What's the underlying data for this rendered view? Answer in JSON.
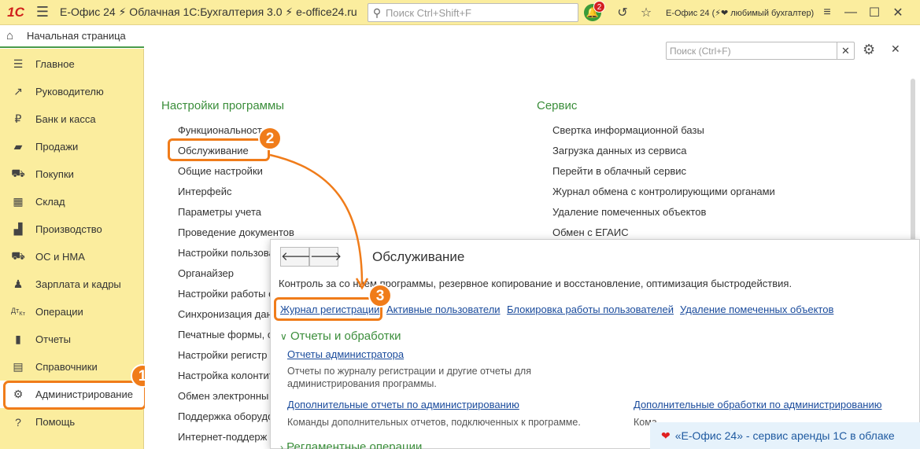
{
  "topbar": {
    "logo": "1С",
    "title": "Е-Офис 24 ⚡ Облачная 1С:Бухгалтерия 3.0 ⚡ e-office24.ru",
    "search_placeholder": "Поиск Ctrl+Shift+F",
    "notifications_count": "2",
    "user": "Е-Офис 24 (⚡❤ любимый бухгалтер)"
  },
  "home_tab": {
    "label": "Начальная страница"
  },
  "sidebar": {
    "items": [
      {
        "label": "Главное",
        "icon": "menu-icon"
      },
      {
        "label": "Руководителю",
        "icon": "chart-trend-icon"
      },
      {
        "label": "Банк и касса",
        "icon": "ruble-icon"
      },
      {
        "label": "Продажи",
        "icon": "bag-icon"
      },
      {
        "label": "Покупки",
        "icon": "cart-icon"
      },
      {
        "label": "Склад",
        "icon": "warehouse-icon"
      },
      {
        "label": "Производство",
        "icon": "factory-icon"
      },
      {
        "label": "ОС и НМА",
        "icon": "truck-icon"
      },
      {
        "label": "Зарплата и кадры",
        "icon": "person-icon"
      },
      {
        "label": "Операции",
        "icon": "dt-kt-icon"
      },
      {
        "label": "Отчеты",
        "icon": "bar-chart-icon"
      },
      {
        "label": "Справочники",
        "icon": "book-icon"
      },
      {
        "label": "Администрирование",
        "icon": "gear-icon"
      },
      {
        "label": "Помощь",
        "icon": "help-icon"
      }
    ]
  },
  "main": {
    "search_placeholder": "Поиск (Ctrl+F)",
    "left_section": {
      "title": "Настройки программы",
      "items": [
        "Функциональност",
        "Обслуживание",
        "Общие настройки",
        "Интерфейс",
        "Параметры учета",
        "Проведение документов",
        "Настройки пользова",
        "Органайзер",
        "Настройки работы с",
        "Синхронизация дан",
        "Печатные формы, о",
        "Настройки регистр",
        "Настройка колонтит",
        "Обмен электронны",
        "Поддержка оборудо",
        "Интернет-поддерж"
      ]
    },
    "right_section": {
      "title": "Сервис",
      "items": [
        "Свертка информационной базы",
        "Загрузка данных из сервиса",
        "Перейти в облачный сервис",
        "Журнал обмена с контролирующими органами",
        "Удаление помеченных объектов",
        "Обмен с ЕГАИС"
      ]
    }
  },
  "popup": {
    "title": "Обслуживание",
    "description": "Контроль за со      нием программы, резервное копирование и восстановление, оптимизация быстродействия.",
    "top_links": [
      "Журнал регистрации",
      "Активные пользователи",
      "Блокировка работы пользователей",
      "Удаление помеченных объектов"
    ],
    "reports_section": {
      "title": "Отчеты и обработки",
      "admin_reports_link": "Отчеты администратора",
      "admin_reports_desc": "Отчеты по журналу регистрации и другие отчеты для администрирования программы.",
      "extra_reports_link": "Дополнительные отчеты по администрированию",
      "extra_reports_desc": "Команды дополнительных отчетов, подключенных к программе.",
      "extra_processing_link": "Дополнительные обработки по администрированию",
      "extra_processing_desc": "Кома"
    },
    "scheduled_section": {
      "title": "Регламентные операции"
    }
  },
  "badges": [
    "1",
    "2",
    "3"
  ],
  "promo": {
    "text": "«Е-Офис 24» - сервис аренды 1С в облаке"
  },
  "colors": {
    "accent": "#f07c1a",
    "green": "#3b8e3b",
    "sidebar": "#fbed9e",
    "link": "#1a4b9c"
  }
}
